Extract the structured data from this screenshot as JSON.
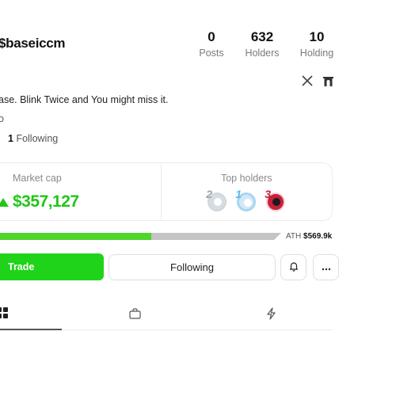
{
  "profile": {
    "handle": "$baseiccm",
    "bio": "ase. Blink Twice and You might miss it.",
    "bio2": "o",
    "following_count": "1",
    "following_label": "Following"
  },
  "stats": [
    {
      "value": "0",
      "label": "Posts"
    },
    {
      "value": "632",
      "label": "Holders"
    },
    {
      "value": "10",
      "label": "Holding"
    }
  ],
  "socials": [
    {
      "icon": "x-icon"
    },
    {
      "icon": "arch-icon"
    }
  ],
  "market": {
    "label": "Market cap",
    "value": "$357,127",
    "trend_icon": "triangle-up-icon",
    "color": "#22c519"
  },
  "top_holders": {
    "label": "Top holders",
    "ranks": [
      "2",
      "1",
      "3"
    ],
    "rank_colors": [
      "#9aa3a8",
      "#5cb8ec",
      "#c8203a"
    ]
  },
  "progress": {
    "fraction": 0.55,
    "fill_color": "#4ed62a",
    "track_color": "#c4c4c4",
    "ath_label": "ATH",
    "ath_value": "$569.9k"
  },
  "actions": {
    "trade_label": "Trade",
    "following_label": "Following",
    "bell_icon": "bell-icon",
    "more_icon": "more-icon"
  },
  "tabs": [
    {
      "icon": "grid-icon",
      "active": true
    },
    {
      "icon": "bag-icon",
      "active": false
    },
    {
      "icon": "bolt-icon",
      "active": false
    }
  ]
}
